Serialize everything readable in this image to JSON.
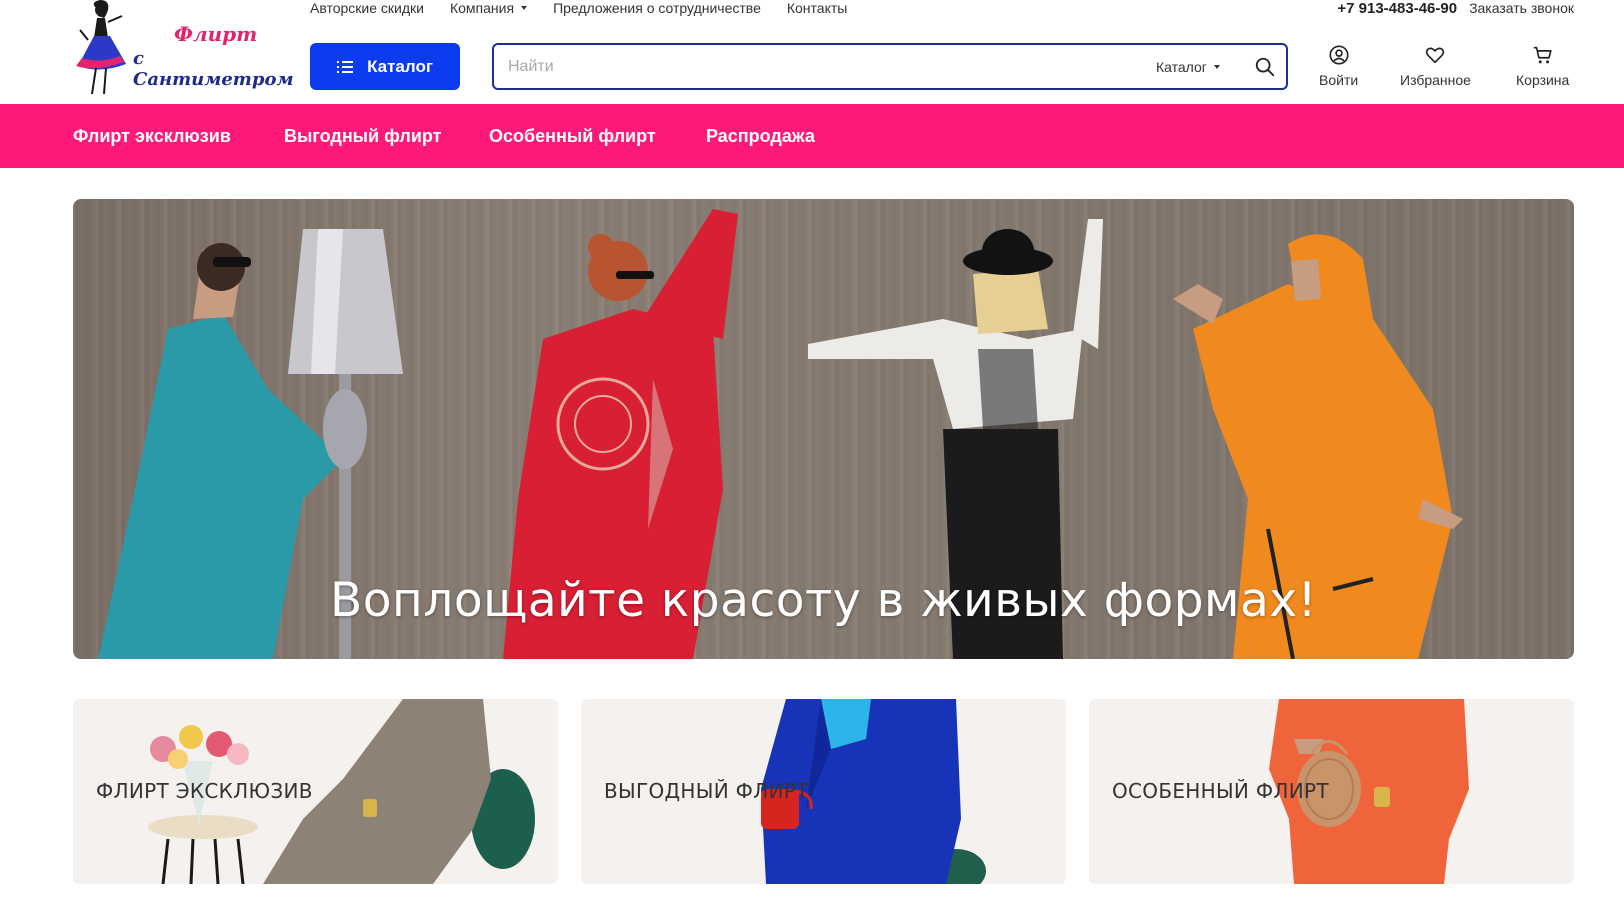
{
  "brand": {
    "logo_line1": "Флирт",
    "logo_line2": "с Сантиметром"
  },
  "topnav": {
    "items": [
      {
        "label": "Авторские скидки",
        "has_dropdown": false
      },
      {
        "label": "Компания",
        "has_dropdown": true
      },
      {
        "label": "Предложения о сотрудничестве",
        "has_dropdown": false
      },
      {
        "label": "Контакты",
        "has_dropdown": false
      }
    ]
  },
  "contact": {
    "phone": "+7 913-483-46-90",
    "callback_label": "Заказать звонок"
  },
  "catalog_button": {
    "label": "Каталог",
    "icon": "list-icon"
  },
  "search": {
    "placeholder": "Найти",
    "value": "",
    "scope_label": "Каталог",
    "icon": "search-icon"
  },
  "user_actions": {
    "login": {
      "label": "Войти",
      "icon": "user-icon"
    },
    "favorites": {
      "label": "Избранное",
      "icon": "heart-icon"
    },
    "cart": {
      "label": "Корзина",
      "icon": "cart-icon"
    }
  },
  "category_nav": {
    "items": [
      {
        "label": "Флирт эксклюзив"
      },
      {
        "label": "Выгодный флирт"
      },
      {
        "label": "Особенный флирт"
      },
      {
        "label": "Распродажа"
      }
    ]
  },
  "hero": {
    "heading": "Воплощайте красоту в живых формах!"
  },
  "cards": [
    {
      "label": "ФЛИРТ ЭКСКЛЮЗИВ"
    },
    {
      "label": "ВЫГОДНЫЙ ФЛИРТ"
    },
    {
      "label": "ОСОБЕННЫЙ ФЛИРТ"
    }
  ],
  "colors": {
    "accent_blue": "#0b3cf0",
    "search_border": "#1e2f8f",
    "nav_pink": "#ff1a7a",
    "card_bg": "#f4f1ef"
  }
}
